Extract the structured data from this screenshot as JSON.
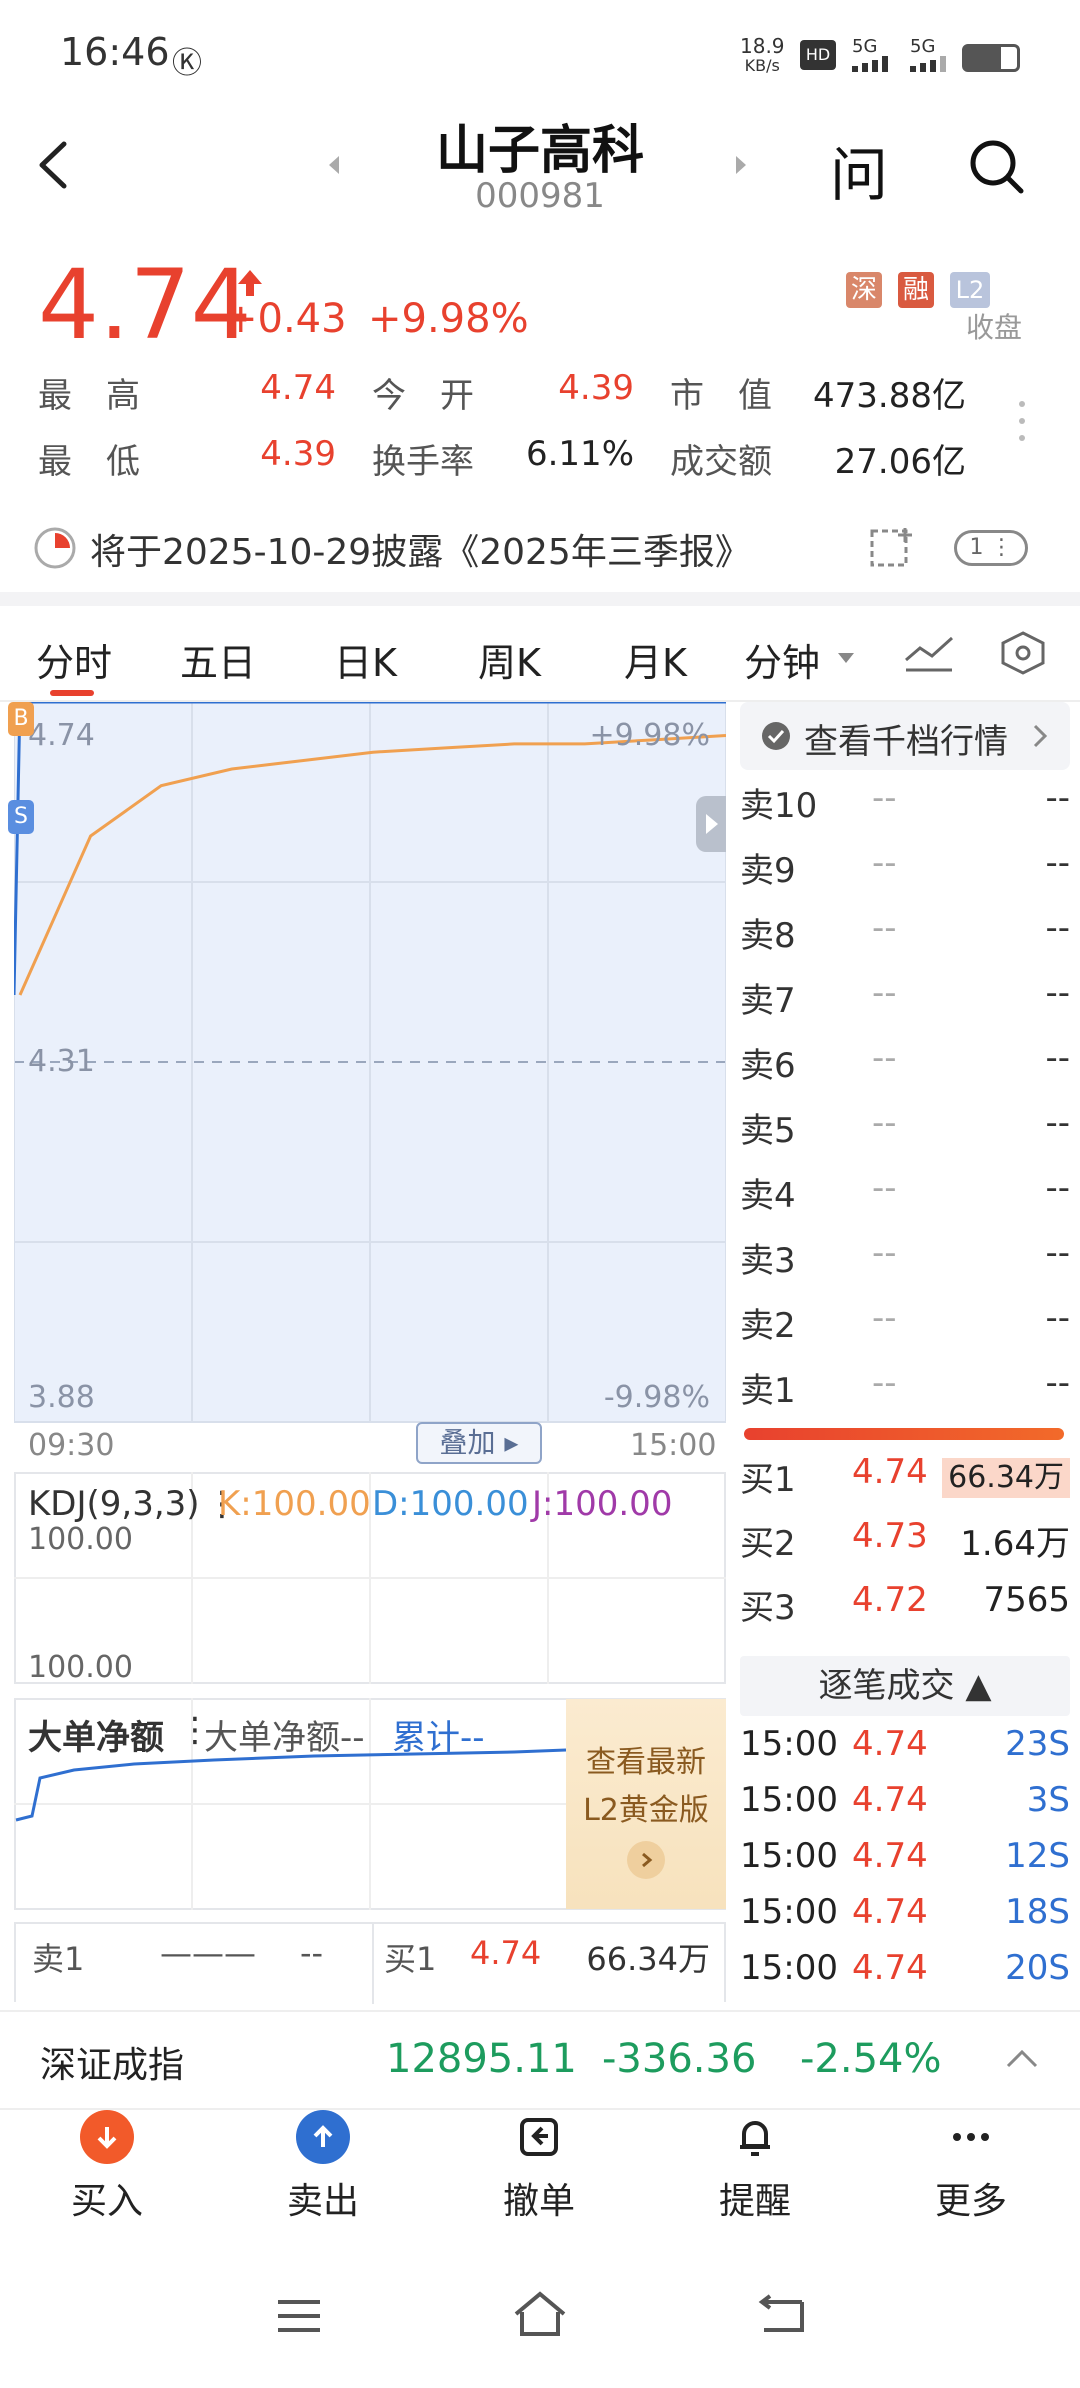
{
  "status_bar": {
    "time": "16:46",
    "k_icon": "Ⓚ",
    "net_speed": "18.9",
    "net_unit": "KB/s",
    "signal1": "5G",
    "signal2": "5G"
  },
  "header": {
    "stock_name": "山子高科",
    "stock_code": "000981",
    "ask_label": "问"
  },
  "quote": {
    "price": "4.74",
    "change": "+0.43",
    "change_pct": "+9.98%",
    "tag_sz": "深",
    "tag_rong": "融",
    "tag_l2": "L2",
    "status": "收盘",
    "high_label": "最　高",
    "high": "4.74",
    "open_label": "今　开",
    "open": "4.39",
    "cap_label": "市　值",
    "cap": "473.88亿",
    "low_label": "最　低",
    "low": "4.39",
    "turnover_label": "换手率",
    "turnover": "6.11%",
    "amount_label": "成交额",
    "amount": "27.06亿"
  },
  "notice": {
    "text": "将于2025-10-29披露《2025年三季报》",
    "badge": "1"
  },
  "tabs": [
    "分时",
    "五日",
    "日K",
    "周K",
    "月K",
    "分钟"
  ],
  "chart_labels": {
    "ymax": "4.74",
    "ymid": "4.31",
    "ymin": "3.88",
    "pmax": "+9.98%",
    "pmin": "-9.98%",
    "t_start": "09:30",
    "t_end": "15:00",
    "overlay": "叠加 ▸",
    "b_mark": "B",
    "s_mark": "S"
  },
  "chart_data": {
    "type": "line",
    "x": [
      "09:30",
      "15:00"
    ],
    "ylim": [
      3.88,
      4.74
    ],
    "series": [
      {
        "values": [
          4.39,
          4.74,
          4.74,
          4.74,
          4.74,
          4.74
        ]
      },
      {
        "values": [
          4.39,
          4.58,
          4.64,
          4.66,
          4.67,
          4.68,
          4.685,
          4.69,
          4.69,
          4.695,
          4.7
        ]
      }
    ]
  },
  "kdj": {
    "title": "KDJ(9,3,3)",
    "k": "K:100.00",
    "d": "D:100.00",
    "j": "J:100.00",
    "top": "100.00",
    "bottom": "100.00"
  },
  "bigorder": {
    "title": "大单净额",
    "label": "大单净额--",
    "cum": "累计--",
    "promo1": "查看最新",
    "promo2": "L2黄金版"
  },
  "bottom_quote": {
    "sell_label": "卖1",
    "sell_price": "———",
    "sell_vol": "--",
    "buy_label": "买1",
    "buy_price": "4.74",
    "buy_vol": "66.34万"
  },
  "orderbook": {
    "header": "查看千档行情",
    "asks": [
      {
        "label": "卖10",
        "price": "--",
        "vol": "--"
      },
      {
        "label": "卖9",
        "price": "--",
        "vol": "--"
      },
      {
        "label": "卖8",
        "price": "--",
        "vol": "--"
      },
      {
        "label": "卖7",
        "price": "--",
        "vol": "--"
      },
      {
        "label": "卖6",
        "price": "--",
        "vol": "--"
      },
      {
        "label": "卖5",
        "price": "--",
        "vol": "--"
      },
      {
        "label": "卖4",
        "price": "--",
        "vol": "--"
      },
      {
        "label": "卖3",
        "price": "--",
        "vol": "--"
      },
      {
        "label": "卖2",
        "price": "--",
        "vol": "--"
      },
      {
        "label": "卖1",
        "price": "--",
        "vol": "--"
      }
    ],
    "bids": [
      {
        "label": "买1",
        "price": "4.74",
        "vol": "66.34万"
      },
      {
        "label": "买2",
        "price": "4.73",
        "vol": "1.64万"
      },
      {
        "label": "买3",
        "price": "4.72",
        "vol": "7565"
      }
    ],
    "trades_header": "逐笔成交 ▲",
    "trades": [
      {
        "time": "15:00",
        "price": "4.74",
        "vol": "23S"
      },
      {
        "time": "15:00",
        "price": "4.74",
        "vol": "3S"
      },
      {
        "time": "15:00",
        "price": "4.74",
        "vol": "12S"
      },
      {
        "time": "15:00",
        "price": "4.74",
        "vol": "18S"
      },
      {
        "time": "15:00",
        "price": "4.74",
        "vol": "20S"
      }
    ]
  },
  "index_bar": {
    "name": "深证成指",
    "value": "12895.11",
    "change": "-336.36",
    "pct": "-2.54%"
  },
  "bottom_nav": {
    "buy": "买入",
    "sell": "卖出",
    "cancel": "撤单",
    "alert": "提醒",
    "more": "更多"
  },
  "colors": {
    "up": "#e8412e",
    "down": "#1d9c5e",
    "chart_bg": "#eaf0fb",
    "price_line": "#2f6fd0",
    "avg_line": "#f0a050"
  }
}
